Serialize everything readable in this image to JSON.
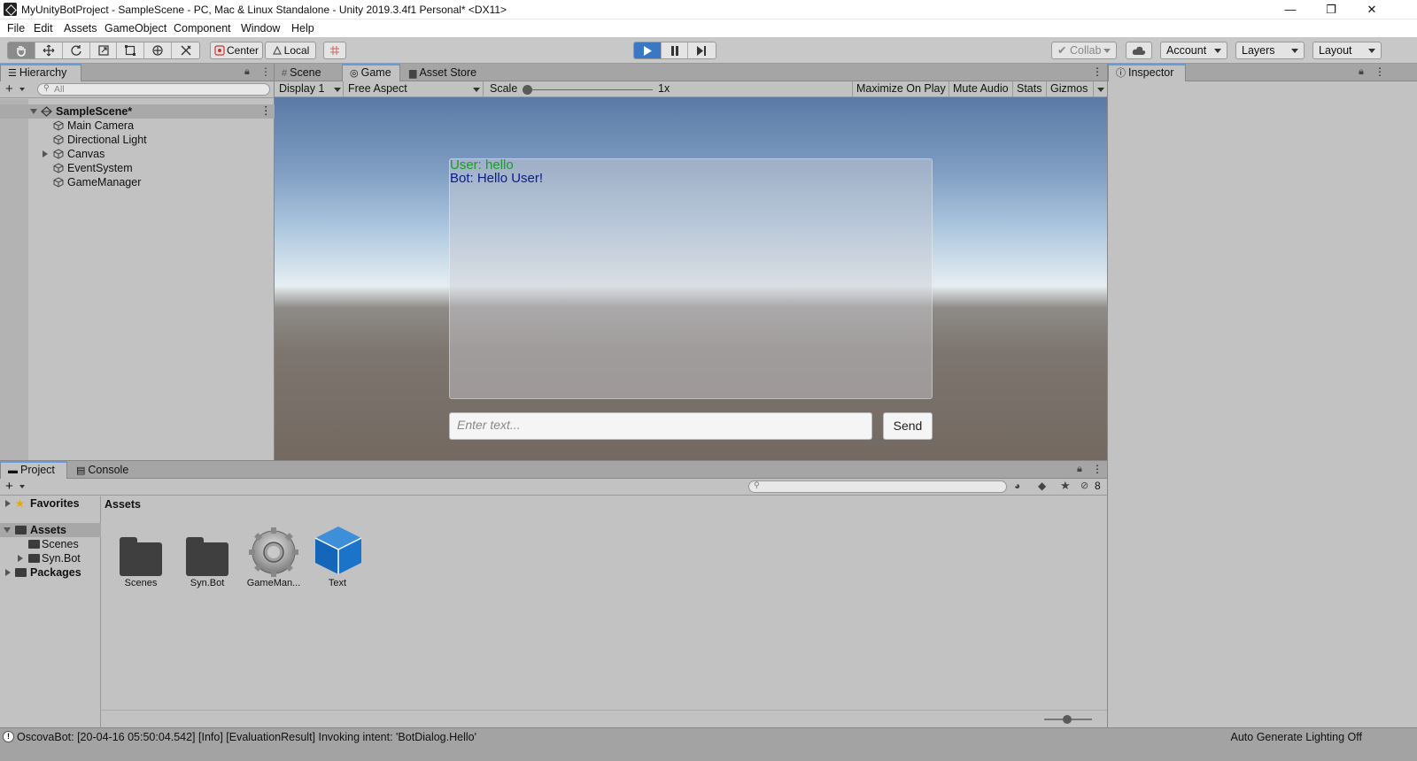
{
  "window": {
    "title": "MyUnityBotProject - SampleScene - PC, Mac & Linux Standalone - Unity 2019.3.4f1 Personal* <DX11>",
    "controls": [
      "—",
      "❐",
      "✕"
    ]
  },
  "menu": [
    "File",
    "Edit",
    "Assets",
    "GameObject",
    "Component",
    "Window",
    "Help"
  ],
  "toolbar": {
    "pivot_center": "Center",
    "pivot_local": "Local",
    "collab": "Collab",
    "account": "Account",
    "layers": "Layers",
    "layout": "Layout"
  },
  "hierarchy": {
    "tab": "Hierarchy",
    "search_placeholder": "All",
    "scene": "SampleScene*",
    "items": [
      "Main Camera",
      "Directional Light",
      "Canvas",
      "EventSystem",
      "GameManager"
    ]
  },
  "center_tabs": [
    "Scene",
    "Game",
    "Asset Store"
  ],
  "game_bar": {
    "display": "Display 1",
    "aspect": "Free Aspect",
    "scale_label": "Scale",
    "scale_value": "1x",
    "scale_level": 0,
    "buttons": [
      "Maximize On Play",
      "Mute Audio",
      "Stats",
      "Gizmos"
    ]
  },
  "game": {
    "chat_user": "User: hello",
    "chat_bot": "Bot: Hello User!",
    "input_placeholder": "Enter text...",
    "send": "Send",
    "user_color": "#1e9a2c",
    "bot_color": "#0a1b8a"
  },
  "inspector": {
    "tab": "Inspector"
  },
  "project": {
    "tabs": [
      "Project",
      "Console"
    ],
    "hidden_count": "8",
    "tree": {
      "favorites": "Favorites",
      "assets": "Assets",
      "scenes": "Scenes",
      "synbot": "Syn.Bot",
      "packages": "Packages"
    },
    "breadcrumb": "Assets",
    "assets": [
      "Scenes",
      "Syn.Bot",
      "GameMan...",
      "Text"
    ]
  },
  "status": {
    "message": "OscovaBot: [20-04-16 05:50:04.542] [Info] [EvaluationResult] Invoking intent: 'BotDialog.Hello'",
    "right": "Auto Generate Lighting Off"
  }
}
